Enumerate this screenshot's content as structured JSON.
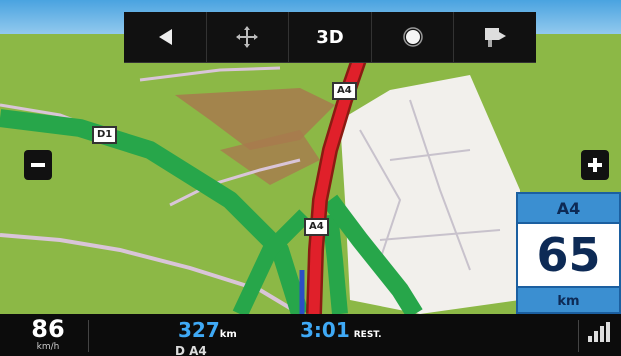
{
  "toolbar": {
    "items": [
      {
        "name": "back",
        "icon": "left-triangle-icon"
      },
      {
        "name": "pan",
        "icon": "crosshair-move-icon"
      },
      {
        "name": "view3d",
        "label": "3D"
      },
      {
        "name": "daynight",
        "icon": "sun-icon"
      },
      {
        "name": "menu",
        "icon": "flag-pointer-icon"
      }
    ]
  },
  "map": {
    "shields": {
      "d1": "D1",
      "a4_top": "A4",
      "a4_mid": "A4"
    }
  },
  "speed_limit": {
    "road": "A4",
    "value": "65",
    "unit": "km"
  },
  "bottom": {
    "speed": "86",
    "speed_unit": "km/h",
    "distance": "327",
    "distance_unit": "km",
    "time": "3:01",
    "time_label": "REST.",
    "route": "D   A4"
  },
  "colors": {
    "route": "#e0202a",
    "highway": "#27a64a",
    "terrain": "#8cb846",
    "accent": "#3fa9f5"
  }
}
